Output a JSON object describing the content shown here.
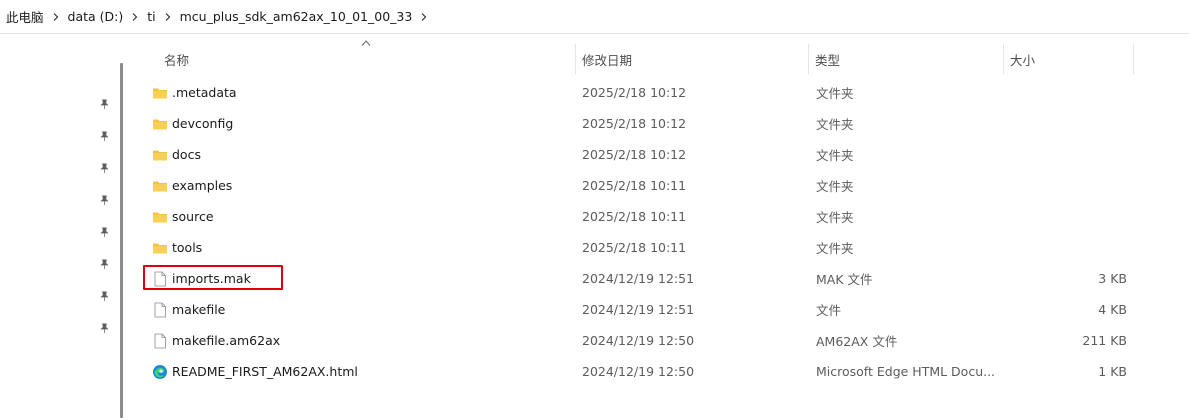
{
  "breadcrumb": {
    "items": [
      "此电脑",
      "data (D:)",
      "ti",
      "mcu_plus_sdk_am62ax_10_01_00_33"
    ]
  },
  "columns": {
    "name": "名称",
    "date": "修改日期",
    "type": "类型",
    "size": "大小"
  },
  "files": [
    {
      "name": ".metadata",
      "date": "2025/2/18 10:12",
      "type": "文件夹",
      "size": "",
      "icon": "folder-icon"
    },
    {
      "name": "devconfig",
      "date": "2025/2/18 10:12",
      "type": "文件夹",
      "size": "",
      "icon": "folder-icon"
    },
    {
      "name": "docs",
      "date": "2025/2/18 10:12",
      "type": "文件夹",
      "size": "",
      "icon": "folder-icon"
    },
    {
      "name": "examples",
      "date": "2025/2/18 10:11",
      "type": "文件夹",
      "size": "",
      "icon": "folder-icon"
    },
    {
      "name": "source",
      "date": "2025/2/18 10:11",
      "type": "文件夹",
      "size": "",
      "icon": "folder-icon"
    },
    {
      "name": "tools",
      "date": "2025/2/18 10:11",
      "type": "文件夹",
      "size": "",
      "icon": "folder-icon"
    },
    {
      "name": "imports.mak",
      "date": "2024/12/19 12:51",
      "type": "MAK 文件",
      "size": "3 KB",
      "icon": "file-icon"
    },
    {
      "name": "makefile",
      "date": "2024/12/19 12:51",
      "type": "文件",
      "size": "4 KB",
      "icon": "file-icon"
    },
    {
      "name": "makefile.am62ax",
      "date": "2024/12/19 12:50",
      "type": "AM62AX 文件",
      "size": "211 KB",
      "icon": "file-icon"
    },
    {
      "name": "README_FIRST_AM62AX.html",
      "date": "2024/12/19 12:50",
      "type": "Microsoft Edge HTML Docu...",
      "size": "1 KB",
      "icon": "edge-icon"
    }
  ],
  "colors": {
    "folder": "#f4c242",
    "highlight": "#e0000d",
    "edge": "#1b8ad8"
  }
}
